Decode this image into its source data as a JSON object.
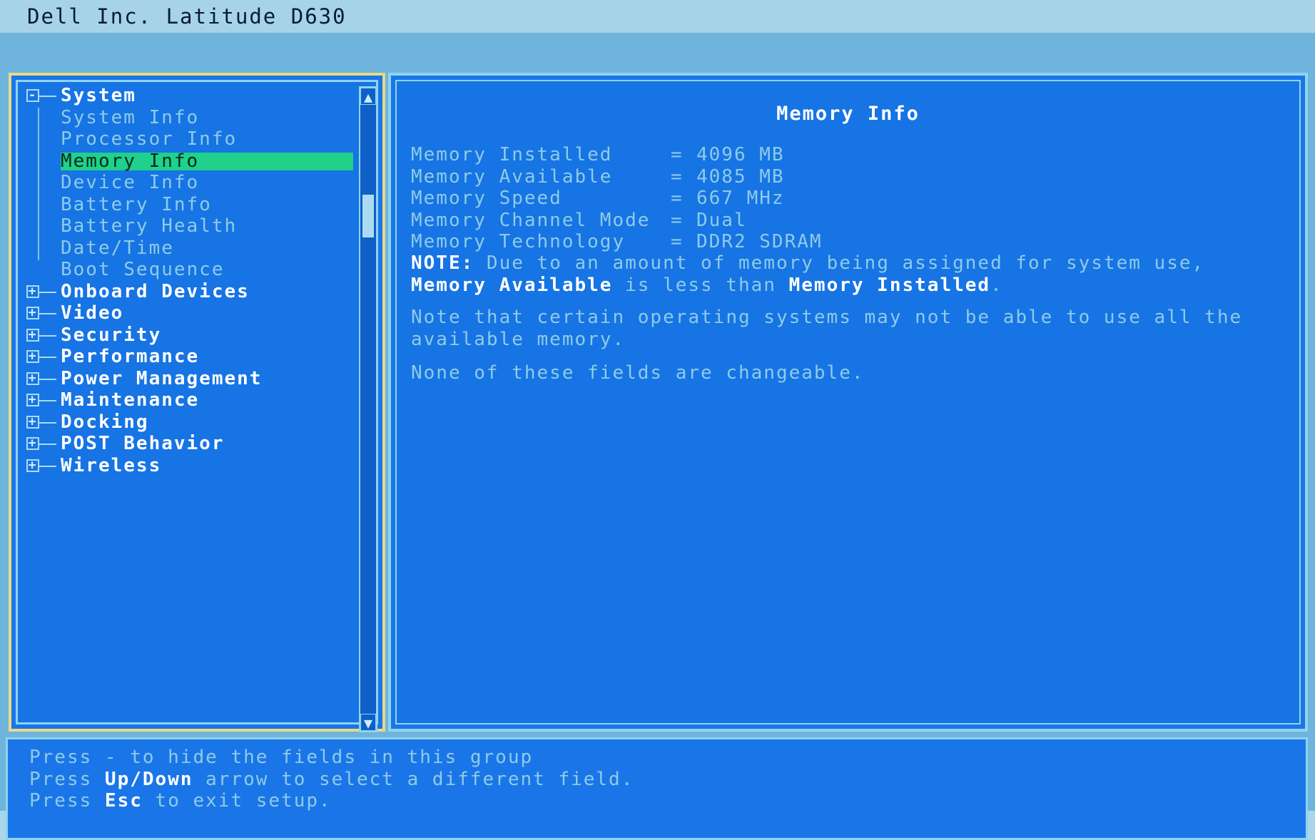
{
  "title": "Dell Inc. Latitude D630",
  "tree": {
    "system": {
      "label": "System",
      "expander": "-"
    },
    "children": [
      "System Info",
      "Processor Info",
      "Memory Info",
      "Device Info",
      "Battery Info",
      "Battery Health",
      "Date/Time",
      "Boot Sequence"
    ],
    "selected_child": "Memory Info",
    "groups": [
      "Onboard Devices",
      "Video",
      "Security",
      "Performance",
      "Power Management",
      "Maintenance",
      "Docking",
      "POST Behavior",
      "Wireless"
    ],
    "group_expander": "+"
  },
  "scrollbar": {
    "up_icon": "arrow-up",
    "down_icon": "arrow-down"
  },
  "detail": {
    "heading": "Memory Info",
    "fields": [
      {
        "label": "Memory Installed",
        "eq": "=",
        "value": "4096 MB"
      },
      {
        "label": "Memory Available",
        "eq": "=",
        "value": "4085 MB"
      },
      {
        "label": "Memory Speed",
        "eq": "=",
        "value": "667 MHz"
      },
      {
        "label": "Memory Channel Mode",
        "eq": "=",
        "value": "Dual"
      },
      {
        "label": "Memory Technology",
        "eq": "=",
        "value": "DDR2 SDRAM"
      }
    ],
    "note": {
      "prefix": "NOTE:",
      "text1": " Due to an amount of memory being assigned for system use,",
      "bold1": "Memory Available",
      "text2": " is less than ",
      "bold2": "Memory Installed",
      "text3": "."
    },
    "para2": "Note that certain operating systems may not be able to use all the available memory.",
    "para3": "None of these fields are changeable."
  },
  "help": {
    "line1": "Press - to hide the fields in this group",
    "line2_pre": "Press ",
    "line2_key": "Up/Down",
    "line2_post": " arrow to select a different field.",
    "line3_pre": "Press ",
    "line3_key": "Esc",
    "line3_post": " to exit setup."
  },
  "colors": {
    "background": "#1674e4",
    "selection": "#1fd18a",
    "text_dim": "#8fcbe8",
    "text_bright": "#ffffff"
  }
}
